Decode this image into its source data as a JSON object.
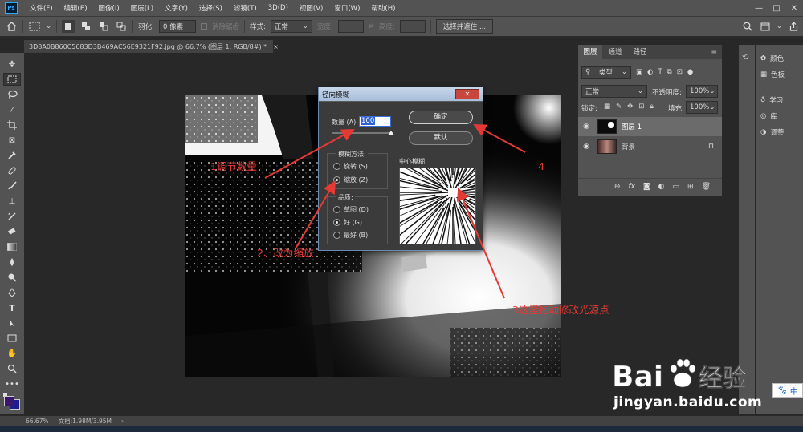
{
  "menubar": {
    "logo": "Ps",
    "items": [
      "文件(F)",
      "编辑(E)",
      "图像(I)",
      "图层(L)",
      "文字(Y)",
      "选择(S)",
      "滤镜(T)",
      "3D(D)",
      "视图(V)",
      "窗口(W)",
      "帮助(H)"
    ],
    "window_controls": [
      "—",
      "□",
      "✕"
    ]
  },
  "options": {
    "feather_label": "羽化:",
    "feather_value": "0 像素",
    "antialias_label": "消除锯齿",
    "style_label": "样式:",
    "style_value": "正常",
    "width_label": "宽度:",
    "height_label": "高度:",
    "select_mask_button": "选择并遮住 ..."
  },
  "document": {
    "tab_title": "3D8A0B860C5683D3B469AC56E9321F92.jpg @ 66.7% (图层 1, RGB/8#) *",
    "tab_close": "×"
  },
  "status": {
    "zoom": "66.67%",
    "doc_info": "文档:1.98M/3.95M"
  },
  "dialog": {
    "title": "径向模糊",
    "amount_label": "数量 (A)",
    "amount_value": "100",
    "ok_button": "确定",
    "default_button": "默认",
    "method_label": "模糊方法:",
    "method_spin": "旋转 (S)",
    "method_zoom": "缩放 (Z)",
    "method_selected": "zoom",
    "quality_label": "品质:",
    "quality_draft": "草图 (D)",
    "quality_good": "好 (G)",
    "quality_best": "最好 (B)",
    "quality_selected": "good",
    "center_label": "中心模糊"
  },
  "layers_panel": {
    "tabs": [
      "图层",
      "通道",
      "路径"
    ],
    "filter_kind": "类型",
    "blend_mode": "正常",
    "opacity_label": "不透明度:",
    "opacity_value": "100%",
    "lock_label": "锁定:",
    "fill_label": "填充:",
    "fill_value": "100%",
    "layers": [
      {
        "name": "图层 1",
        "selected": true
      },
      {
        "name": "背景",
        "selected": false,
        "locked": true
      }
    ],
    "footer_icons": [
      "link-icon",
      "fx-icon",
      "mask-icon",
      "adjustment-icon",
      "group-icon",
      "new-layer-icon",
      "trash-icon"
    ]
  },
  "side_panels": {
    "group1": [
      "颜色",
      "色板"
    ],
    "group2": [
      "学习",
      "库",
      "调整"
    ]
  },
  "annotations": {
    "a1": "1调节数量",
    "a2": "2、改为缩放",
    "a3": "3这里拖动修改光源点",
    "a4": "4"
  },
  "watermark": {
    "url": "jingyan.baidu.com",
    "ime": "中"
  },
  "colors": {
    "annotation": "#e53935",
    "foreground_swatch": "#3a1670",
    "background_swatch": "#1d1c8c"
  }
}
